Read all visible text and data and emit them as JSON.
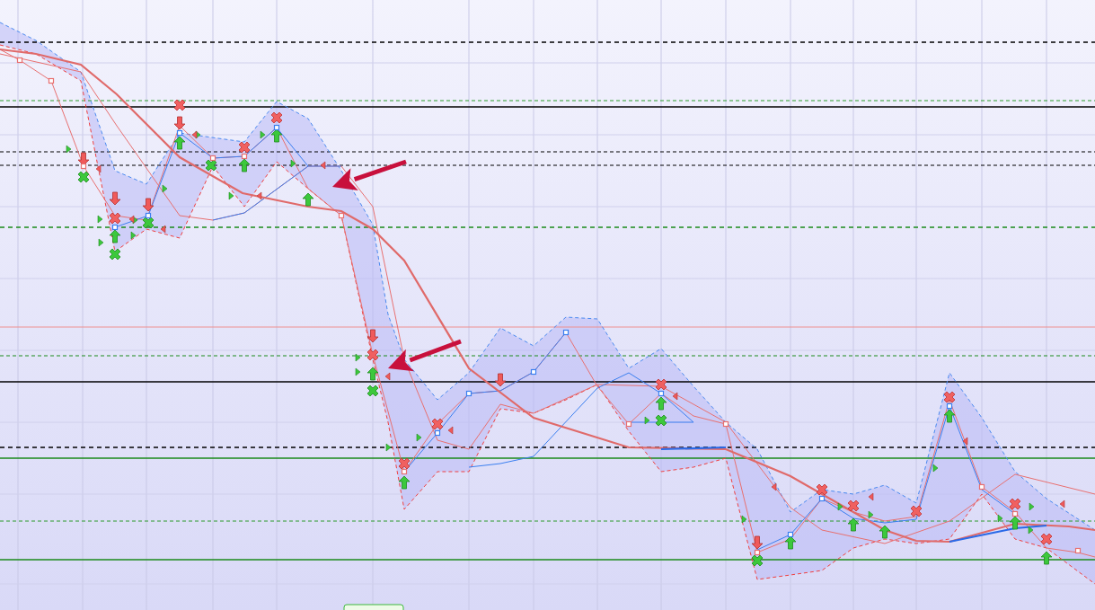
{
  "chart": {
    "kind": "band-chart"
  }
}
